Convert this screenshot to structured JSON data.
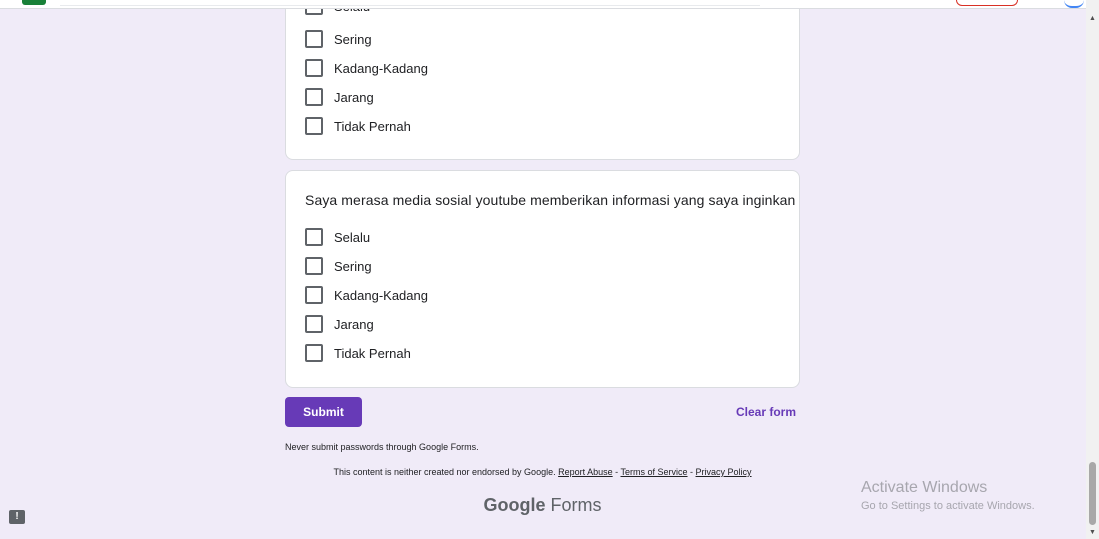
{
  "card1": {
    "options": [
      "Selalu",
      "Sering",
      "Kadang-Kadang",
      "Jarang",
      "Tidak Pernah"
    ]
  },
  "card2": {
    "question": "Saya merasa media sosial youtube memberikan informasi yang saya inginkan",
    "options": [
      "Selalu",
      "Sering",
      "Kadang-Kadang",
      "Jarang",
      "Tidak Pernah"
    ]
  },
  "actions": {
    "submit_label": "Submit",
    "clear_label": "Clear form"
  },
  "footer": {
    "never_text": "Never submit passwords through Google Forms.",
    "disclaimer_text": "This content is neither created nor endorsed by Google.",
    "report_abuse": "Report Abuse",
    "sep1": " - ",
    "terms": "Terms of Service",
    "sep2": " - ",
    "privacy": "Privacy Policy",
    "brand_google": "Google",
    "brand_forms": "Forms"
  },
  "windows_watermark": {
    "title": "Activate Windows",
    "subtitle": "Go to Settings to activate Windows."
  },
  "icons": {
    "feedback": "feedback-icon",
    "scroll_up": "arrow-up-icon",
    "scroll_down": "arrow-down-icon"
  },
  "colors": {
    "background": "#f0ebf8",
    "accent": "#673ab7"
  }
}
